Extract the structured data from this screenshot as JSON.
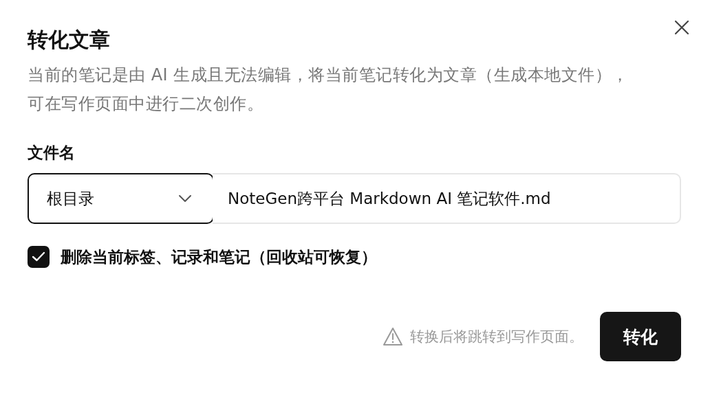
{
  "dialog": {
    "title": "转化文章",
    "description": "当前的笔记是由 AI 生成且无法编辑，将当前笔记转化为文章（生成本地文件），可在写作页面中进行二次创作。"
  },
  "file_name": {
    "label": "文件名",
    "folder": "根目录",
    "value": "NoteGen跨平台 Markdown AI 笔记软件.md"
  },
  "delete_option": {
    "label": "删除当前标签、记录和笔记（回收站可恢复）",
    "checked": true
  },
  "footer": {
    "hint": "转换后将跳转到写作页面。",
    "button": "转化"
  }
}
